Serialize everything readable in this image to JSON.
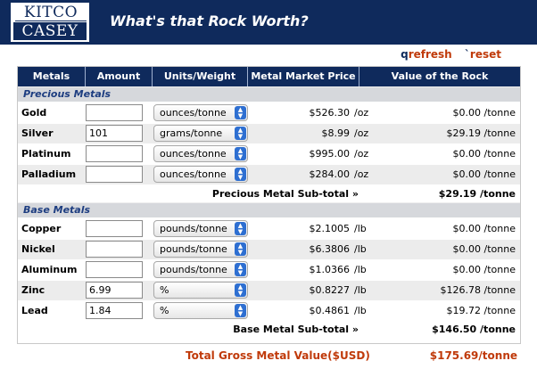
{
  "brand": {
    "logo_top": "KITCO",
    "logo_bottom": "CASEY"
  },
  "app": {
    "title": "What's that Rock Worth?"
  },
  "actions": {
    "refresh": {
      "hotkey": "q",
      "label": "refresh"
    },
    "reset": {
      "hotkey": "`",
      "label": "reset"
    }
  },
  "columns": [
    "Metals",
    "Amount",
    "Units/Weight",
    "Metal Market Price",
    "Value of the Rock"
  ],
  "sections": {
    "precious": {
      "label": "Precious Metals",
      "rows": [
        {
          "metal": "Gold",
          "amount": "",
          "unit": "ounces/tonne",
          "price": "$526.30",
          "per": "/oz",
          "value": "$0.00 /tonne"
        },
        {
          "metal": "Silver",
          "amount": "101",
          "unit": "grams/tonne",
          "price": "$8.99",
          "per": "/oz",
          "value": "$29.19 /tonne"
        },
        {
          "metal": "Platinum",
          "amount": "",
          "unit": "ounces/tonne",
          "price": "$995.00",
          "per": "/oz",
          "value": "$0.00 /tonne"
        },
        {
          "metal": "Palladium",
          "amount": "",
          "unit": "ounces/tonne",
          "price": "$284.00",
          "per": "/oz",
          "value": "$0.00 /tonne"
        }
      ],
      "subtotal_label": "Precious Metal Sub-total »",
      "subtotal_value": "$29.19 /tonne"
    },
    "base": {
      "label": "Base Metals",
      "rows": [
        {
          "metal": "Copper",
          "amount": "",
          "unit": "pounds/tonne",
          "price": "$2.1005",
          "per": "/lb",
          "value": "$0.00 /tonne"
        },
        {
          "metal": "Nickel",
          "amount": "",
          "unit": "pounds/tonne",
          "price": "$6.3806",
          "per": "/lb",
          "value": "$0.00 /tonne"
        },
        {
          "metal": "Aluminum",
          "amount": "",
          "unit": "pounds/tonne",
          "price": "$1.0366",
          "per": "/lb",
          "value": "$0.00 /tonne"
        },
        {
          "metal": "Zinc",
          "amount": "6.99",
          "unit": "%",
          "price": "$0.8227",
          "per": "/lb",
          "value": "$126.78 /tonne"
        },
        {
          "metal": "Lead",
          "amount": "1.84",
          "unit": "%",
          "price": "$0.4861",
          "per": "/lb",
          "value": "$19.72 /tonne"
        }
      ],
      "subtotal_label": "Base Metal Sub-total »",
      "subtotal_value": "$146.50 /tonne"
    }
  },
  "total": {
    "label": "Total Gross Metal Value($USD)",
    "value": "$175.69/tonne"
  },
  "colors": {
    "header_navy": "#0f2a5c",
    "accent_red": "#c03a0a",
    "section_text": "#1d3d80",
    "select_arrow": "#2e6fd1"
  },
  "icons": {
    "select_arrow": "chevron-up-down-icon"
  }
}
